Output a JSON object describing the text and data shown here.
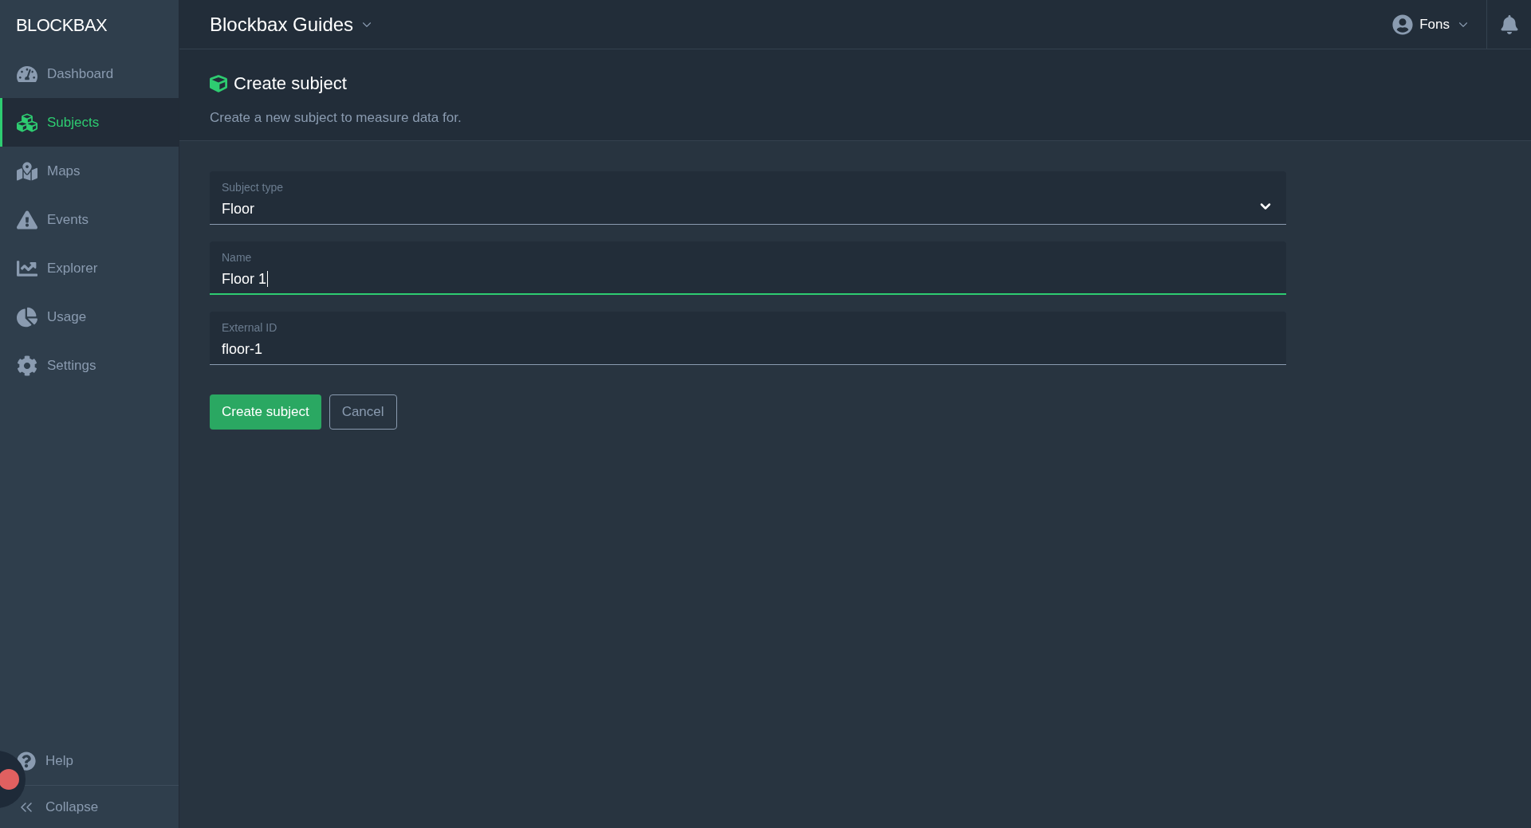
{
  "logo": "BLOCKBAX",
  "sidebar": {
    "items": [
      {
        "label": "Dashboard",
        "selected": false
      },
      {
        "label": "Subjects",
        "selected": true
      },
      {
        "label": "Maps",
        "selected": false
      },
      {
        "label": "Events",
        "selected": false
      },
      {
        "label": "Explorer",
        "selected": false
      },
      {
        "label": "Usage",
        "selected": false
      },
      {
        "label": "Settings",
        "selected": false
      }
    ],
    "help": "Help",
    "collapse": "Collapse"
  },
  "header": {
    "project": "Blockbax Guides",
    "user": "Fons"
  },
  "page": {
    "title": "Create subject",
    "subtitle": "Create a new subject to measure data for."
  },
  "form": {
    "fields": [
      {
        "kind": "select",
        "label": "Subject type",
        "value": "Floor",
        "focused": false
      },
      {
        "kind": "text",
        "label": "Name",
        "value": "Floor 1",
        "focused": true
      },
      {
        "kind": "text",
        "label": "External ID",
        "value": "floor-1",
        "focused": false
      }
    ],
    "buttons": [
      {
        "label": "Create subject",
        "kind": "primary"
      },
      {
        "label": "Cancel",
        "kind": "secondary"
      }
    ]
  }
}
